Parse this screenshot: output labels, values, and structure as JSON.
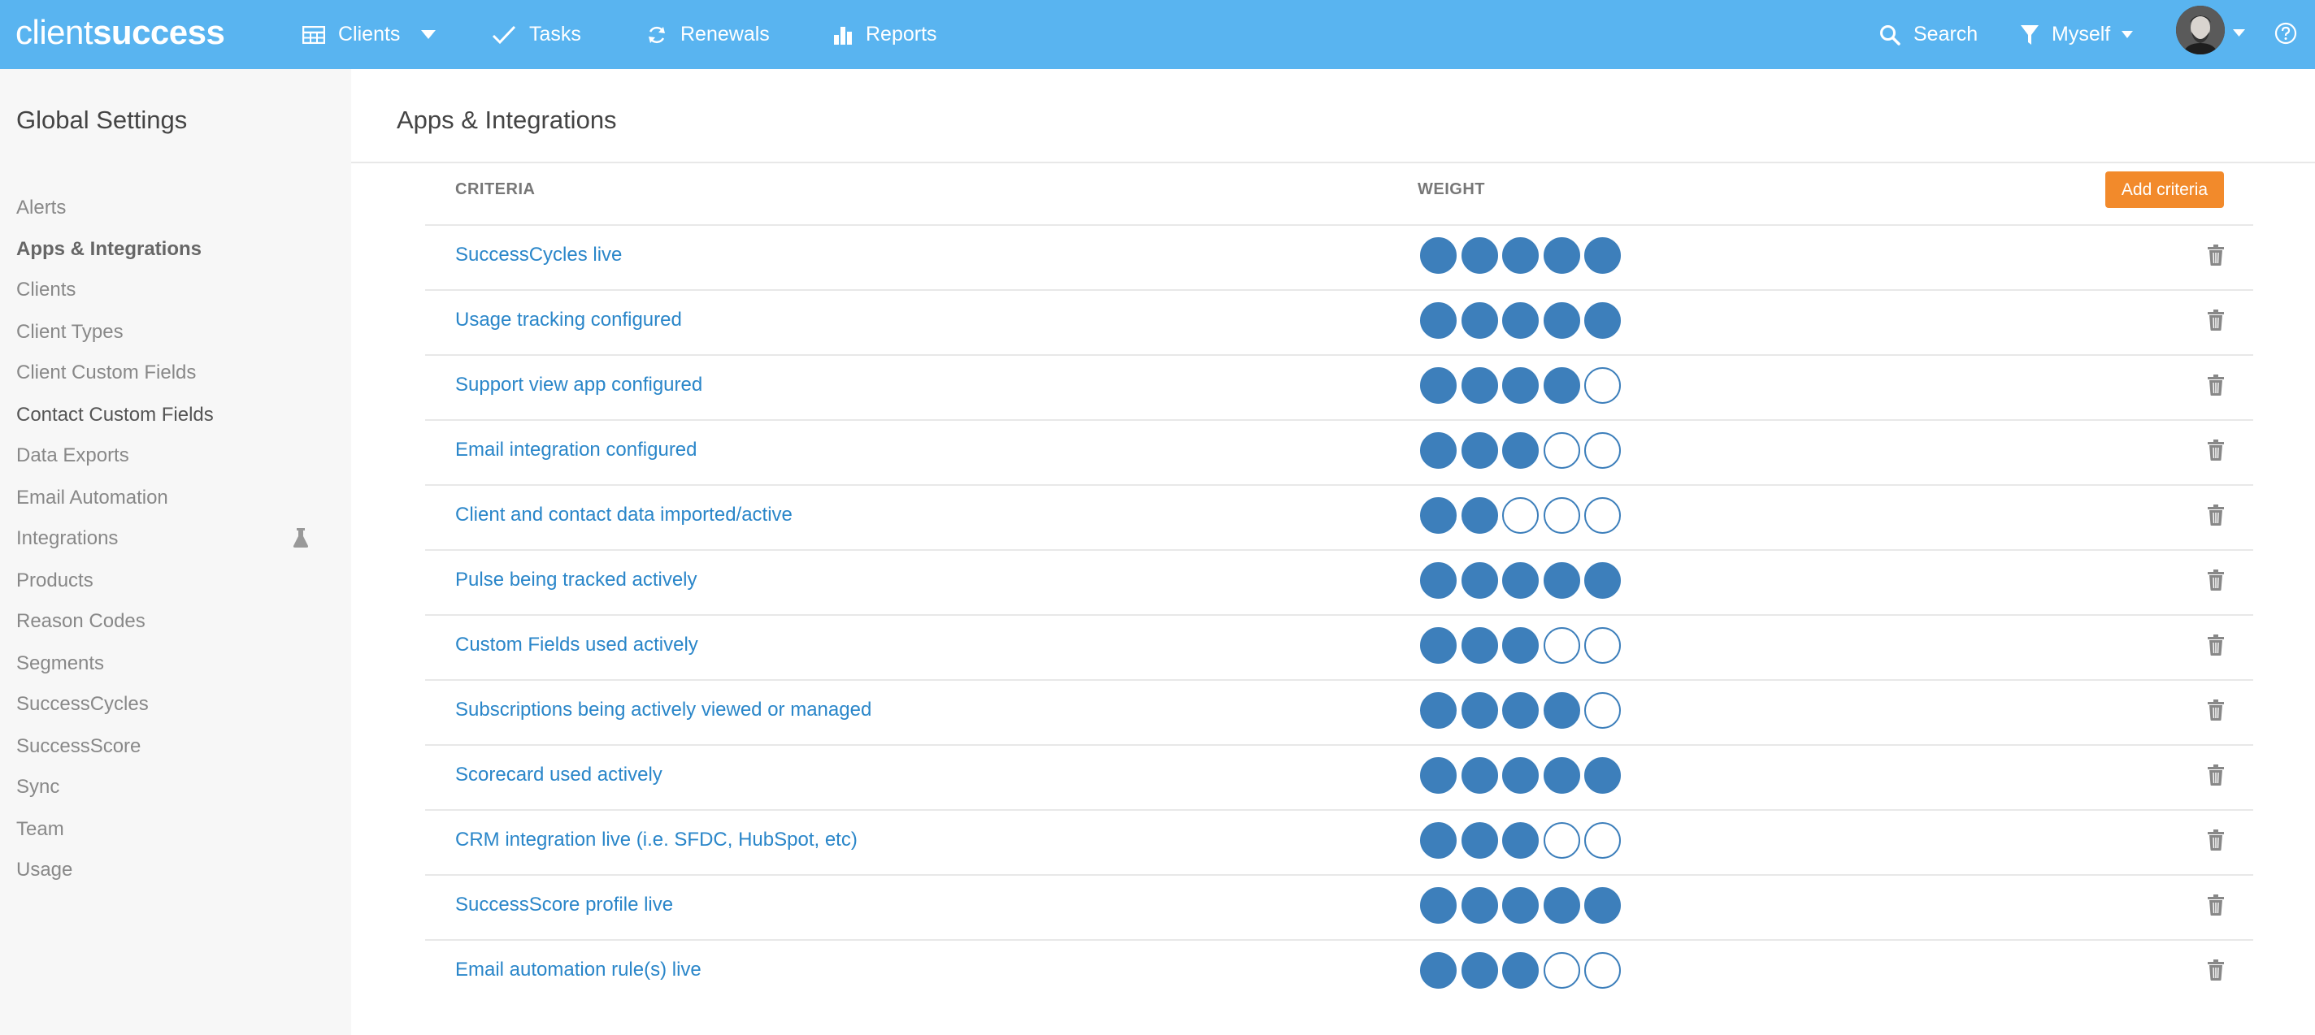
{
  "brand": {
    "part1": "client",
    "part2": "success"
  },
  "nav": {
    "clients": "Clients",
    "tasks": "Tasks",
    "renewals": "Renewals",
    "reports": "Reports",
    "search": "Search",
    "filter": "Myself"
  },
  "sidebar": {
    "title": "Global Settings",
    "items": [
      {
        "label": "Alerts"
      },
      {
        "label": "Apps & Integrations"
      },
      {
        "label": "Clients"
      },
      {
        "label": "Client Types"
      },
      {
        "label": "Client Custom Fields"
      },
      {
        "label": "Contact Custom Fields"
      },
      {
        "label": "Data Exports"
      },
      {
        "label": "Email Automation"
      },
      {
        "label": "Integrations"
      },
      {
        "label": "Products"
      },
      {
        "label": "Reason Codes"
      },
      {
        "label": "Segments"
      },
      {
        "label": "SuccessCycles"
      },
      {
        "label": "SuccessScore"
      },
      {
        "label": "Sync"
      },
      {
        "label": "Team"
      },
      {
        "label": "Usage"
      }
    ]
  },
  "main": {
    "title": "Apps & Integrations",
    "col_criteria": "CRITERIA",
    "col_weight": "WEIGHT",
    "add_button": "Add criteria",
    "weight_max": 5,
    "rows": [
      {
        "label": "SuccessCycles live",
        "weight": 5
      },
      {
        "label": "Usage tracking configured",
        "weight": 5
      },
      {
        "label": "Support view app configured",
        "weight": 4
      },
      {
        "label": "Email integration configured",
        "weight": 3
      },
      {
        "label": "Client and contact data imported/active",
        "weight": 2
      },
      {
        "label": "Pulse being tracked actively",
        "weight": 5
      },
      {
        "label": "Custom Fields used actively",
        "weight": 3
      },
      {
        "label": "Subscriptions being actively viewed or managed",
        "weight": 4
      },
      {
        "label": "Scorecard used actively",
        "weight": 5
      },
      {
        "label": "CRM integration live (i.e. SFDC, HubSpot, etc)",
        "weight": 3
      },
      {
        "label": "SuccessScore profile live",
        "weight": 5
      },
      {
        "label": "Email automation rule(s) live",
        "weight": 3
      }
    ]
  },
  "colors": {
    "topbar": "#59b4f0",
    "accent": "#2a86c9",
    "dot": "#3d7fbb",
    "button": "#f28a2b"
  },
  "icons": [
    "grid-icon",
    "chevron-down-icon",
    "check-icon",
    "refresh-icon",
    "bar-chart-icon",
    "search-icon",
    "filter-icon",
    "help-icon",
    "flask-icon",
    "trash-icon"
  ]
}
